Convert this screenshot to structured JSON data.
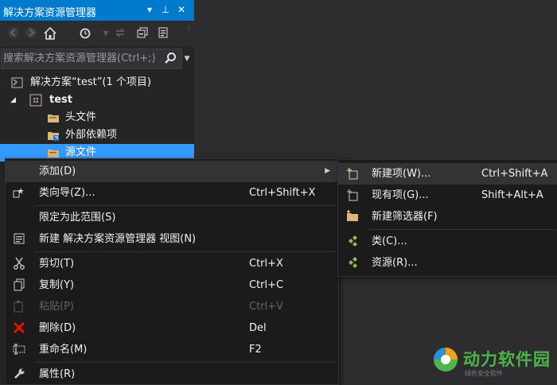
{
  "panel": {
    "title": "解决方案资源管理器",
    "title_buttons": [
      "▾",
      "⊥",
      "✕"
    ],
    "search_placeholder": "搜索解决方案资源管理器(Ctrl+;)"
  },
  "tree": {
    "solution": "解决方案“test”(1 个项目)",
    "project": "test",
    "items": [
      "头文件",
      "外部依赖项",
      "源文件"
    ]
  },
  "context_menu": {
    "items": [
      {
        "label": "添加(D)",
        "shortcut": "",
        "icon": "",
        "submenu": true
      },
      {
        "label": "类向导(Z)...",
        "shortcut": "Ctrl+Shift+X",
        "icon": "class-wizard-icon"
      },
      {
        "label": "限定为此范围(S)",
        "shortcut": "",
        "icon": ""
      },
      {
        "label": "新建 解决方案资源管理器 视图(N)",
        "shortcut": "",
        "icon": "new-view-icon"
      },
      {
        "label": "剪切(T)",
        "shortcut": "Ctrl+X",
        "icon": "scissors-icon"
      },
      {
        "label": "复制(Y)",
        "shortcut": "Ctrl+C",
        "icon": "copy-icon"
      },
      {
        "label": "粘贴(P)",
        "shortcut": "Ctrl+V",
        "icon": "paste-icon",
        "disabled": true
      },
      {
        "label": "删除(D)",
        "shortcut": "Del",
        "icon": "delete-icon"
      },
      {
        "label": "重命名(M)",
        "shortcut": "F2",
        "icon": "rename-icon"
      },
      {
        "label": "属性(R)",
        "shortcut": "",
        "icon": "wrench-icon"
      }
    ]
  },
  "submenu": {
    "items": [
      {
        "label": "新建项(W)...",
        "shortcut": "Ctrl+Shift+A",
        "icon": "new-item-icon"
      },
      {
        "label": "现有项(G)...",
        "shortcut": "Shift+Alt+A",
        "icon": "existing-item-icon"
      },
      {
        "label": "新建筛选器(F)",
        "shortcut": "",
        "icon": "new-filter-icon"
      },
      {
        "label": "类(C)...",
        "shortcut": "",
        "icon": "class-icon"
      },
      {
        "label": "资源(R)...",
        "shortcut": "",
        "icon": "resource-icon"
      }
    ]
  },
  "watermark": {
    "text": "动力软件园",
    "sub": "绿色安全软件"
  },
  "colors": {
    "accent": "#007acc",
    "selection": "#3399ff",
    "menu_bg": "#1b1b1c",
    "watermark_green": "#4cb648"
  }
}
